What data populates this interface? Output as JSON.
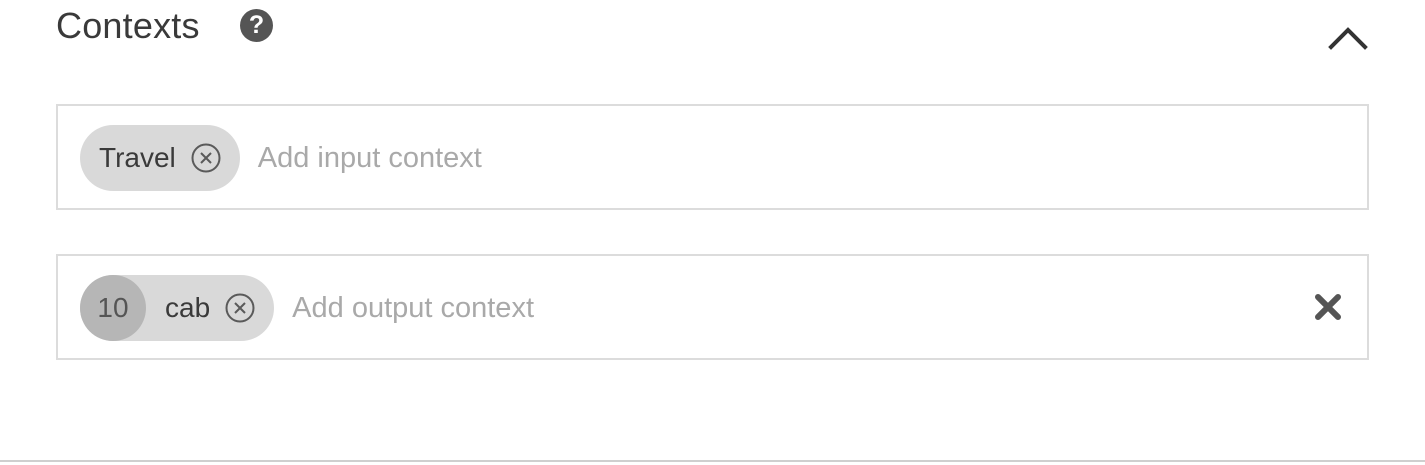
{
  "header": {
    "title": "Contexts",
    "help_icon": "help-circle-icon",
    "collapse_icon": "chevron-up-icon"
  },
  "input_contexts": {
    "chips": [
      {
        "label": "Travel",
        "remove_icon": "remove-circle-icon"
      }
    ],
    "placeholder": "Add input context"
  },
  "output_contexts": {
    "chips": [
      {
        "lifespan": "10",
        "label": "cab",
        "remove_icon": "remove-circle-icon"
      }
    ],
    "placeholder": "Add output context",
    "clear_icon": "close-icon"
  },
  "colors": {
    "chip_background": "#d9d9d9",
    "lifespan_background": "#b6b6b6",
    "border": "#dcdcdc",
    "icon": "#555555"
  }
}
